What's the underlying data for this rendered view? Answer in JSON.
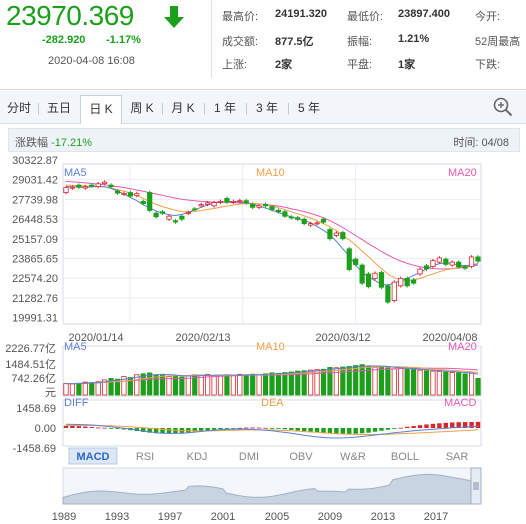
{
  "quote": {
    "price": "23970.369",
    "change": "-282.920",
    "change_pct": "-1.17%",
    "datetime": "2020-04-08 16:08",
    "stats": {
      "high_label": "最高价:",
      "high": "24191.320",
      "low_label": "最低价:",
      "low": "23897.400",
      "open_label": "今开:",
      "turnover_label": "成交额:",
      "turnover": "877.5亿",
      "amplitude_label": "振幅:",
      "amplitude": "1.21%",
      "week52_label": "52周最高",
      "up_label": "上涨:",
      "up": "2家",
      "flat_label": "平盘:",
      "flat": "1家",
      "down_label": "下跌:"
    },
    "colors": {
      "down": "#1ca01c",
      "up": "#d9252b"
    }
  },
  "tabs": [
    "分时",
    "五日",
    "日 K",
    "周 K",
    "月 K",
    "1 年",
    "3 年",
    "5 年"
  ],
  "active_tab": "日 K",
  "zoom_icon": "zoom-in-icon",
  "info": {
    "change_label": "涨跌幅",
    "change_value": "-17.21%",
    "time_label": "时间:",
    "time_value": "04/08"
  },
  "chart_data": [
    {
      "type": "candlestick",
      "y_ticks": [
        "30322.87",
        "29031.42",
        "27739.98",
        "26448.53",
        "25157.09",
        "23865.65",
        "22574.20",
        "21282.76",
        "19991.31"
      ],
      "ylim": [
        19991.31,
        30322.87
      ],
      "x_labels": [
        "2020/01/14",
        "2020/02/13",
        "2020/03/12",
        "2020/04/08"
      ],
      "ma_labels": [
        "MA5",
        "MA10",
        "MA20"
      ],
      "close": [
        28930,
        28960,
        28950,
        28990,
        29050,
        29190,
        29300,
        28990,
        28560,
        28540,
        28360,
        28540,
        27850,
        27390,
        26960,
        27200,
        27000,
        26610,
        26800,
        27250,
        27450,
        27780,
        27900,
        27920,
        28000,
        27950,
        28000,
        28050,
        27900,
        27600,
        27700,
        27700,
        27450,
        27300,
        27000,
        26890,
        26790,
        26500,
        26500,
        26550,
        26600,
        25480,
        25860,
        25480,
        23400,
        23730,
        22480,
        22250,
        23150,
        22200,
        21200,
        22550,
        22800,
        22300,
        22480,
        23430,
        23440,
        24000,
        24180,
        23750,
        23900,
        23580,
        23490,
        24250,
        23970
      ],
      "open": [
        28600,
        28900,
        29100,
        28900,
        29100,
        29000,
        29200,
        29100,
        28700,
        28500,
        28600,
        28400,
        28000,
        28600,
        27200,
        27300,
        26800,
        26700,
        27000,
        27200,
        27500,
        27700,
        27800,
        27700,
        27950,
        28200,
        27950,
        28000,
        28050,
        27800,
        27600,
        27800,
        27650,
        27400,
        27300,
        26950,
        26900,
        26800,
        26400,
        26500,
        26800,
        26100,
        25700,
        25900,
        24800,
        24100,
        23700,
        23100,
        22800,
        23200,
        22300,
        21300,
        22300,
        22800,
        22700,
        23100,
        23650,
        23600,
        23900,
        24100,
        23700,
        23900,
        23600,
        23600,
        24250
      ],
      "ma5": [
        29000,
        28990,
        28970,
        28950,
        28980,
        29010,
        29000,
        28880,
        28700,
        28500,
        28280,
        28050,
        27780,
        27550,
        27350,
        27200,
        27100,
        27050,
        27120,
        27250,
        27450,
        27600,
        27760,
        27900,
        27950,
        27980,
        27990,
        27960,
        27900,
        27800,
        27700,
        27550,
        27400,
        27250,
        27100,
        26950,
        26820,
        26700,
        26560,
        26300,
        26050,
        25750,
        25300,
        24800,
        24300,
        23700,
        23200,
        22900,
        22650,
        22400,
        22350,
        22500,
        22650,
        22800,
        23000,
        23200,
        23450,
        23650,
        23800,
        23850,
        23800,
        23700,
        23650,
        23700,
        23800
      ],
      "ma10": [
        29100,
        29080,
        29060,
        29040,
        29020,
        29000,
        28980,
        28900,
        28800,
        28700,
        28550,
        28400,
        28200,
        28000,
        27800,
        27650,
        27520,
        27400,
        27320,
        27300,
        27320,
        27380,
        27450,
        27520,
        27600,
        27680,
        27760,
        27820,
        27860,
        27870,
        27830,
        27770,
        27680,
        27570,
        27440,
        27300,
        27160,
        27020,
        26870,
        26700,
        26500,
        26280,
        26020,
        25720,
        25400,
        25050,
        24650,
        24250,
        23850,
        23450,
        23100,
        22850,
        22700,
        22650,
        22700,
        22800,
        22950,
        23100,
        23250,
        23380,
        23450,
        23550,
        23650,
        23720,
        23780
      ],
      "ma20": [
        29350,
        29320,
        29290,
        29250,
        29210,
        29170,
        29120,
        29060,
        29000,
        28940,
        28860,
        28770,
        28680,
        28590,
        28500,
        28410,
        28310,
        28220,
        28150,
        28090,
        28040,
        28000,
        27970,
        27950,
        27940,
        27930,
        27920,
        27900,
        27880,
        27860,
        27830,
        27790,
        27740,
        27680,
        27600,
        27510,
        27410,
        27310,
        27190,
        27050,
        26890,
        26700,
        26480,
        26230,
        25970,
        25700,
        25420,
        25140,
        24880,
        24620,
        24380,
        24160,
        23970,
        23810,
        23690,
        23590,
        23510,
        23460,
        23440,
        23440,
        23460,
        23500,
        23560,
        23630,
        23700
      ]
    },
    {
      "type": "bar",
      "name": "volume",
      "y_ticks": [
        "2226.77亿",
        "1484.51亿",
        "742.26亿",
        "元"
      ],
      "ma_labels": [
        "MA5",
        "MA10",
        "MA20"
      ],
      "values": [
        620,
        610,
        640,
        700,
        680,
        720,
        820,
        900,
        860,
        1000,
        950,
        1100,
        1150,
        1200,
        1100,
        1080,
        1000,
        1050,
        980,
        1050,
        1100,
        1080,
        1120,
        1050,
        1080,
        1100,
        1050,
        1120,
        1100,
        1130,
        1100,
        1150,
        1200,
        1180,
        1220,
        1250,
        1300,
        1320,
        1350,
        1380,
        1400,
        1500,
        1480,
        1520,
        1550,
        1600,
        1650,
        1580,
        1500,
        1550,
        1480,
        1420,
        1450,
        1400,
        1380,
        1350,
        1320,
        1300,
        1280,
        1250,
        1220,
        1200,
        1150,
        1180,
        900
      ]
    },
    {
      "type": "bar",
      "name": "MACD",
      "y_ticks": [
        "1458.69",
        "0.00",
        "-1458.69"
      ],
      "labels": [
        "DIFF",
        "DEA",
        "MACD"
      ],
      "macd": [
        180,
        170,
        150,
        120,
        80,
        40,
        20,
        -20,
        -60,
        -120,
        -180,
        -240,
        -320,
        -380,
        -420,
        -450,
        -460,
        -440,
        -400,
        -360,
        -300,
        -260,
        -200,
        -150,
        -100,
        -60,
        -20,
        10,
        30,
        40,
        30,
        10,
        -20,
        -60,
        -100,
        -150,
        -200,
        -260,
        -300,
        -340,
        -380,
        -420,
        -450,
        -470,
        -480,
        -470,
        -430,
        -380,
        -300,
        -220,
        -140,
        -60,
        20,
        100,
        160,
        230,
        290,
        340,
        380,
        420,
        450,
        470,
        480,
        490,
        500
      ],
      "diff": [
        300,
        290,
        280,
        260,
        240,
        200,
        150,
        100,
        40,
        -20,
        -80,
        -160,
        -240,
        -320,
        -380,
        -420,
        -440,
        -440,
        -420,
        -380,
        -330,
        -280,
        -230,
        -180,
        -140,
        -110,
        -90,
        -80,
        -90,
        -110,
        -140,
        -180,
        -230,
        -290,
        -360,
        -430,
        -510,
        -590,
        -660,
        -720,
        -770,
        -800,
        -810,
        -800,
        -780,
        -740,
        -690,
        -630,
        -570,
        -510,
        -450,
        -390,
        -330,
        -280,
        -230,
        -180,
        -140,
        -100,
        -60,
        -20,
        20,
        50,
        80,
        110,
        140
      ],
      "dea": [
        200,
        205,
        210,
        210,
        208,
        200,
        190,
        175,
        155,
        130,
        100,
        65,
        25,
        -20,
        -65,
        -110,
        -150,
        -185,
        -210,
        -230,
        -240,
        -240,
        -235,
        -225,
        -210,
        -195,
        -180,
        -165,
        -155,
        -150,
        -150,
        -155,
        -165,
        -180,
        -200,
        -225,
        -255,
        -290,
        -325,
        -360,
        -395,
        -430,
        -460,
        -485,
        -505,
        -520,
        -530,
        -530,
        -525,
        -515,
        -500,
        -480,
        -460,
        -440,
        -420,
        -395,
        -370,
        -345,
        -320,
        -295,
        -265,
        -235,
        -205,
        -175,
        -145
      ]
    }
  ],
  "indicator_tabs": [
    "MACD",
    "RSI",
    "KDJ",
    "DMI",
    "OBV",
    "W&R",
    "BOLL",
    "SAR"
  ],
  "active_indicator": "MACD",
  "overview": {
    "x_labels": [
      "1989",
      "1993",
      "1997",
      "2001",
      "2005",
      "2009",
      "2013",
      "2017"
    ],
    "handle_icon": "range-handle-icon"
  }
}
